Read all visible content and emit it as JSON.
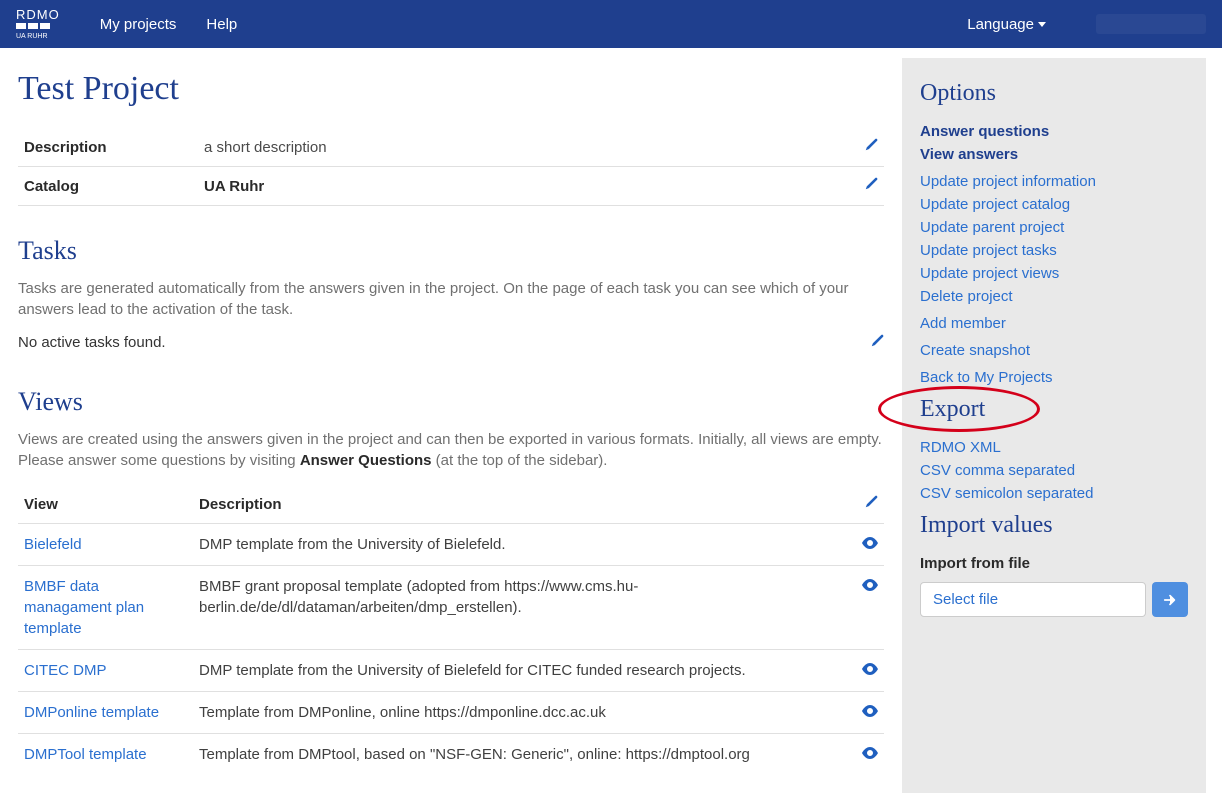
{
  "nav": {
    "brand_top": "RDMO",
    "brand_bottom": "UA RUHR",
    "my_projects": "My projects",
    "help": "Help",
    "language": "Language"
  },
  "project": {
    "title": "Test Project",
    "meta": {
      "description_label": "Description",
      "description_value": "a short description",
      "catalog_label": "Catalog",
      "catalog_value": "UA Ruhr"
    }
  },
  "tasks": {
    "heading": "Tasks",
    "intro": "Tasks are generated automatically from the answers given in the project. On the page of each task you can see which of your answers lead to the activation of the task.",
    "empty": "No active tasks found."
  },
  "views": {
    "heading": "Views",
    "intro_a": "Views are created using the answers given in the project and can then be exported in various formats. Initially, all views are empty. Please answer some questions by visiting ",
    "intro_b": "Answer Questions",
    "intro_c": " (at the top of the sidebar).",
    "col_view": "View",
    "col_desc": "Description",
    "rows": [
      {
        "name": "Bielefeld",
        "desc": "DMP template from the University of Bielefeld."
      },
      {
        "name": "BMBF data managament plan template",
        "desc": "BMBF grant proposal template (adopted from https://www.cms.hu-berlin.de/de/dl/dataman/arbeiten/dmp_erstellen)."
      },
      {
        "name": "CITEC DMP",
        "desc": "DMP template from the University of Bielefeld for CITEC funded research projects."
      },
      {
        "name": "DMPonline template",
        "desc": "Template from DMPonline, online https://dmponline.dcc.ac.uk"
      },
      {
        "name": "DMPTool template",
        "desc": "Template from DMPtool, based on \"NSF-GEN: Generic\", online: https://dmptool.org"
      }
    ]
  },
  "sidebar": {
    "options_heading": "Options",
    "links_primary": [
      "Answer questions",
      "View answers"
    ],
    "links_a": [
      "Update project information",
      "Update project catalog",
      "Update parent project",
      "Update project tasks",
      "Update project views",
      "Delete project"
    ],
    "links_b": [
      "Add member"
    ],
    "links_c": [
      "Create snapshot"
    ],
    "links_d": [
      "Back to My Projects"
    ],
    "export_heading": "Export",
    "export_links": [
      "RDMO XML",
      "CSV comma separated",
      "CSV semicolon separated"
    ],
    "import_heading": "Import values",
    "import_label": "Import from file",
    "import_placeholder": "Select file"
  }
}
